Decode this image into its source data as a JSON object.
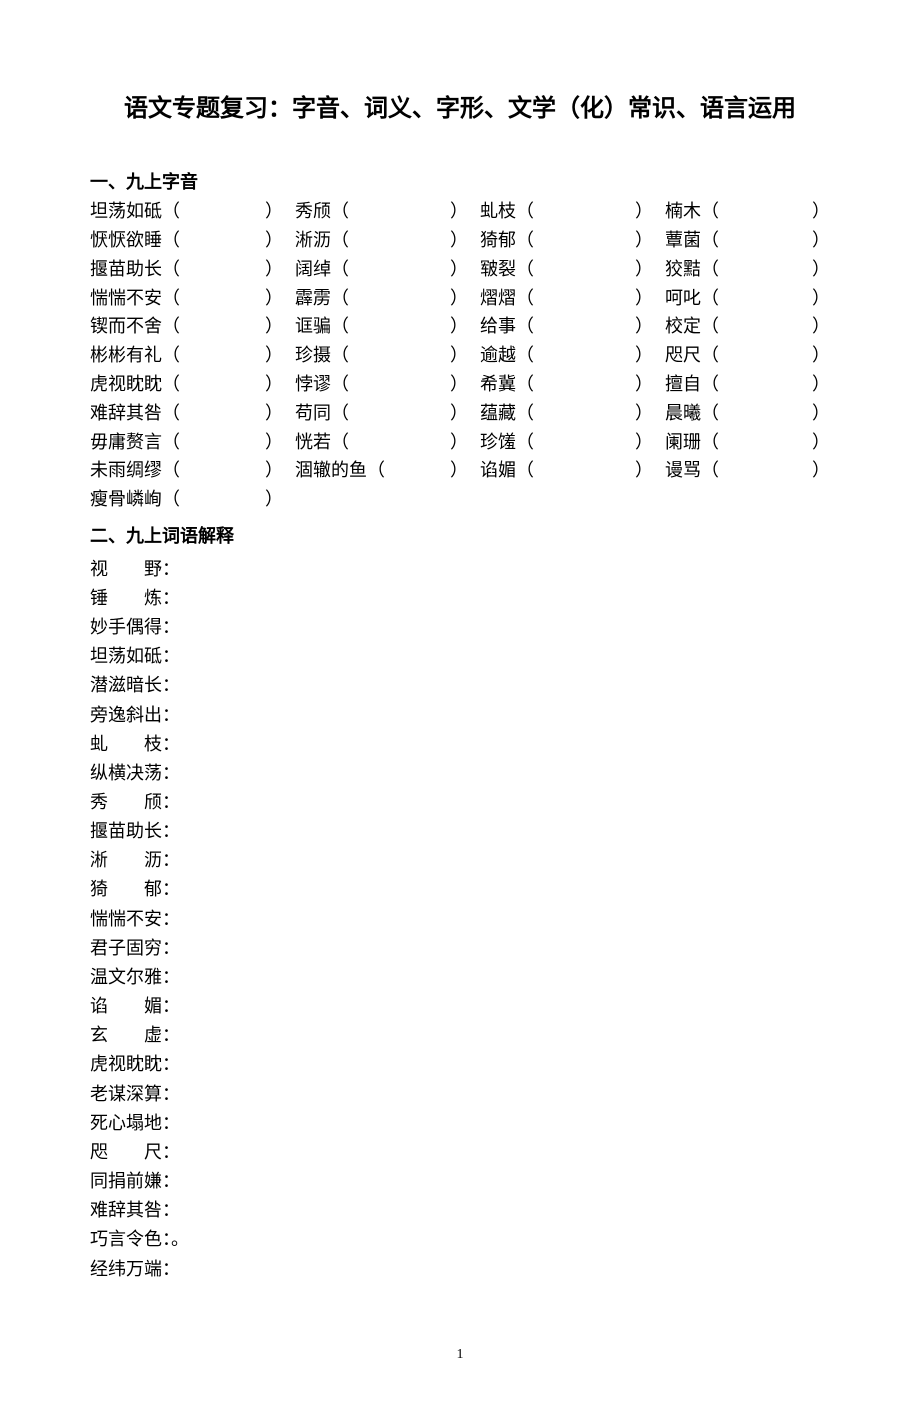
{
  "title": "语文专题复习：字音、词义、字形、文学（化）常识、语言运用",
  "section1_heading": "一、九上字音",
  "ziyin_rows": [
    [
      "坦荡如砥",
      "秀颀",
      "虬枝",
      "楠木"
    ],
    [
      "恹恹欲睡",
      "淅沥",
      "猗郁",
      "蕈菌"
    ],
    [
      "揠苗助长",
      "阔绰",
      "皲裂",
      "狡黠"
    ],
    [
      "惴惴不安",
      "霹雳",
      "熠熠",
      "呵叱"
    ],
    [
      "锲而不舍",
      "诓骗",
      "给事",
      "校定"
    ],
    [
      "彬彬有礼",
      "珍摄",
      "逾越",
      "咫尺"
    ],
    [
      "虎视眈眈",
      "悖谬",
      "希冀",
      "擅自"
    ],
    [
      "难辞其咎",
      "苟同",
      "蕴藏",
      "晨曦"
    ],
    [
      "毋庸赘言",
      "恍若",
      "珍馐",
      "阑珊"
    ],
    [
      "未雨绸缪",
      "涸辙的鱼",
      "谄媚",
      "谩骂"
    ],
    [
      "瘦骨嶙峋"
    ]
  ],
  "section2_heading": "二、九上词语解释",
  "terms": [
    {
      "label": "视野",
      "spread": true
    },
    {
      "label": "锤炼",
      "spread": true
    },
    {
      "label": "妙手偶得",
      "spread": false
    },
    {
      "label": "坦荡如砥",
      "spread": false
    },
    {
      "label": "潜滋暗长",
      "spread": false
    },
    {
      "label": "旁逸斜出",
      "spread": false
    },
    {
      "label": "虬枝",
      "spread": true
    },
    {
      "label": "纵横决荡",
      "spread": false
    },
    {
      "label": "秀颀",
      "spread": true
    },
    {
      "label": "揠苗助长",
      "spread": false
    },
    {
      "label": "淅沥",
      "spread": true
    },
    {
      "label": "猗郁",
      "spread": true
    },
    {
      "label": "惴惴不安",
      "spread": false
    },
    {
      "label": "君子固穷",
      "spread": false
    },
    {
      "label": "温文尔雅",
      "spread": false
    },
    {
      "label": "谄媚",
      "spread": true
    },
    {
      "label": "玄虚",
      "spread": true
    },
    {
      "label": "虎视眈眈",
      "spread": false
    },
    {
      "label": "老谋深算",
      "spread": false
    },
    {
      "label": "死心塌地",
      "spread": false
    },
    {
      "label": "咫尺",
      "spread": true
    },
    {
      "label": "同捐前嫌",
      "spread": false
    },
    {
      "label": "难辞其咎",
      "spread": false
    },
    {
      "label": "巧言令色",
      "spread": false,
      "suffix": "：。"
    },
    {
      "label": "经纬万端",
      "spread": false
    }
  ],
  "open": "（",
  "close": "）",
  "colon": "：",
  "pagenum": "1"
}
